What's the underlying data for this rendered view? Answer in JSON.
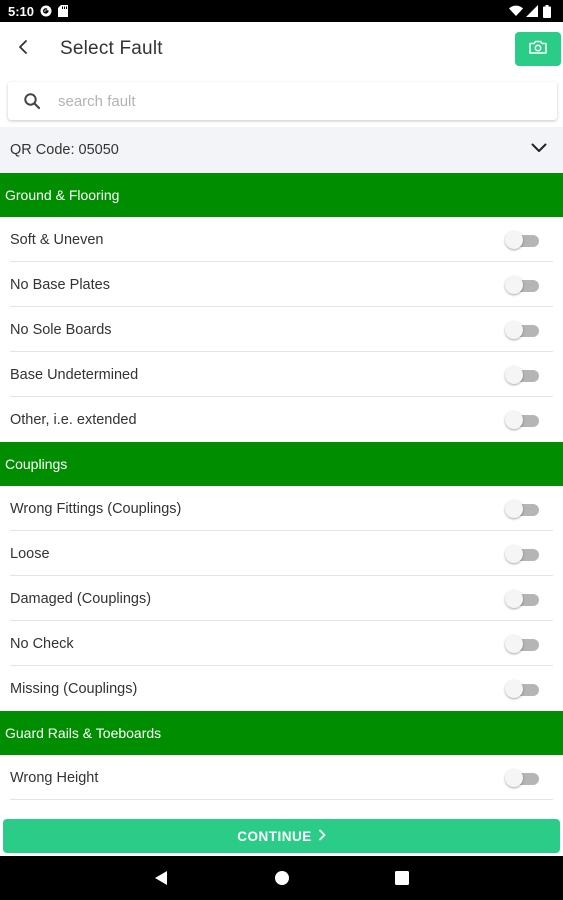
{
  "status_bar": {
    "time": "5:10",
    "left_icons": [
      "g-pay-icon",
      "sd-card-icon"
    ],
    "right_icons": [
      "wifi-icon",
      "signal-icon",
      "battery-icon"
    ]
  },
  "header": {
    "title": "Select Fault",
    "back_icon": "chevron-left-icon",
    "camera_icon": "camera-icon"
  },
  "search": {
    "placeholder": "search fault",
    "value": ""
  },
  "qr": {
    "label": "QR Code: 05050"
  },
  "sections": [
    {
      "title": "Ground & Flooring",
      "items": [
        {
          "label": "Soft & Uneven",
          "checked": false
        },
        {
          "label": "No Base Plates",
          "checked": false
        },
        {
          "label": "No Sole Boards",
          "checked": false
        },
        {
          "label": "Base Undetermined",
          "checked": false
        },
        {
          "label": "Other, i.e. extended",
          "checked": false
        }
      ]
    },
    {
      "title": "Couplings",
      "items": [
        {
          "label": "Wrong Fittings (Couplings)",
          "checked": false
        },
        {
          "label": "Loose",
          "checked": false
        },
        {
          "label": "Damaged (Couplings)",
          "checked": false
        },
        {
          "label": "No Check",
          "checked": false
        },
        {
          "label": "Missing (Couplings)",
          "checked": false
        }
      ]
    },
    {
      "title": "Guard Rails & Toeboards",
      "items": [
        {
          "label": "Wrong Height",
          "checked": false
        }
      ]
    }
  ],
  "footer": {
    "continue_label": "CONTINUE",
    "continue_icon": "chevron-right-icon"
  },
  "colors": {
    "section_header": "#008e00",
    "accent_button": "#2bcc88",
    "qr_row_bg": "#f2f4f7"
  }
}
